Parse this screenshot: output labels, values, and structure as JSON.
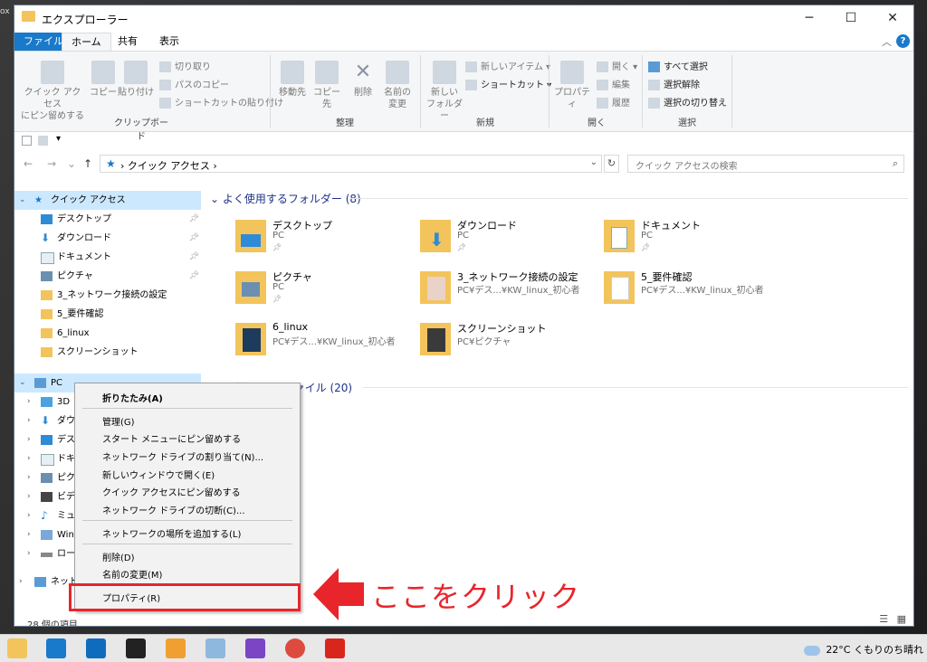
{
  "desktop": {
    "corner_text": "ox"
  },
  "window": {
    "title": "エクスプローラー",
    "minimize": "─",
    "maximize": "☐",
    "close": "✕",
    "help": "?",
    "collapse": "︿"
  },
  "tabs": [
    {
      "label": "ファイル"
    },
    {
      "label": "ホーム"
    },
    {
      "label": "共有"
    },
    {
      "label": "表示"
    }
  ],
  "ribbon": {
    "pin_quick": "クイック アクセス",
    "pin_quick2": "にピン留めする",
    "copy": "コピー",
    "paste": "貼り付け",
    "cut": "切り取り",
    "copy_path": "パスのコピー",
    "paste_shortcut": "ショートカットの貼り付け",
    "group_clipboard": "クリップボード",
    "move_to": "移動先",
    "copy_to": "コピー先",
    "delete": "削除",
    "rename1": "名前の",
    "rename2": "変更",
    "group_organize": "整理",
    "new_folder1": "新しい",
    "new_folder2": "フォルダー",
    "new_item": "新しいアイテム",
    "shortcut": "ショートカット",
    "group_new": "新規",
    "properties": "プロパティ",
    "open": "開く",
    "edit": "編集",
    "history": "履歴",
    "group_open": "開く",
    "select_all": "すべて選択",
    "select_none": "選択解除",
    "invert": "選択の切り替え",
    "group_select": "選択"
  },
  "address": {
    "path": "クイック アクセス",
    "search_placeholder": "クイック アクセスの検索"
  },
  "nav": {
    "quick_access": "クイック アクセス",
    "qa_items": [
      {
        "label": "デスクトップ"
      },
      {
        "label": "ダウンロード"
      },
      {
        "label": "ドキュメント"
      },
      {
        "label": "ピクチャ"
      },
      {
        "label": "3_ネットワーク接続の設定"
      },
      {
        "label": "5_要件確認"
      },
      {
        "label": "6_linux"
      },
      {
        "label": "スクリーンショット"
      }
    ],
    "pc": "PC",
    "pc_items": [
      {
        "label": "3D"
      },
      {
        "label": "ダウ"
      },
      {
        "label": "デス"
      },
      {
        "label": "ドキ"
      },
      {
        "label": "ピク"
      },
      {
        "label": "ビデ"
      },
      {
        "label": "ミュ"
      },
      {
        "label": "Win"
      },
      {
        "label": "ロー"
      }
    ],
    "network": "ネット"
  },
  "content": {
    "frequent_header": "よく使用するフォルダー (8)",
    "recent_header": "最近使用したファイル (20)",
    "folders": [
      {
        "name": "デスクトップ",
        "sub": "PC"
      },
      {
        "name": "ダウンロード",
        "sub": "PC"
      },
      {
        "name": "ドキュメント",
        "sub": "PC"
      },
      {
        "name": "ピクチャ",
        "sub": "PC"
      },
      {
        "name": "3_ネットワーク接続の設定",
        "sub": "PC¥デス...¥KW_linux_初心者"
      },
      {
        "name": "5_要件確認",
        "sub": "PC¥デス...¥KW_linux_初心者"
      },
      {
        "name": "6_linux",
        "sub": "PC¥デス...¥KW_linux_初心者"
      },
      {
        "name": "スクリーンショット",
        "sub": "PC¥ピクチャ"
      }
    ]
  },
  "context_menu": {
    "collapse": "折りたたみ(A)",
    "manage": "管理(G)",
    "pin_start": "スタート メニューにピン留めする",
    "map_drive": "ネットワーク ドライブの割り当て(N)...",
    "new_window": "新しいウィンドウで開く(E)",
    "pin_quick": "クイック アクセスにピン留めする",
    "disconnect": "ネットワーク ドライブの切断(C)...",
    "add_location": "ネットワークの場所を追加する(L)",
    "delete": "削除(D)",
    "rename": "名前の変更(M)",
    "properties": "プロパティ(R)"
  },
  "annotation": "ここをクリック",
  "status": {
    "count": "28 個の項目"
  },
  "taskbar": {
    "weather": "22°C くもりのち晴れ"
  },
  "colors": {
    "accent": "#1979ca",
    "highlight": "#e8252b",
    "selection": "#cce8ff",
    "folder": "#f3c45c"
  }
}
